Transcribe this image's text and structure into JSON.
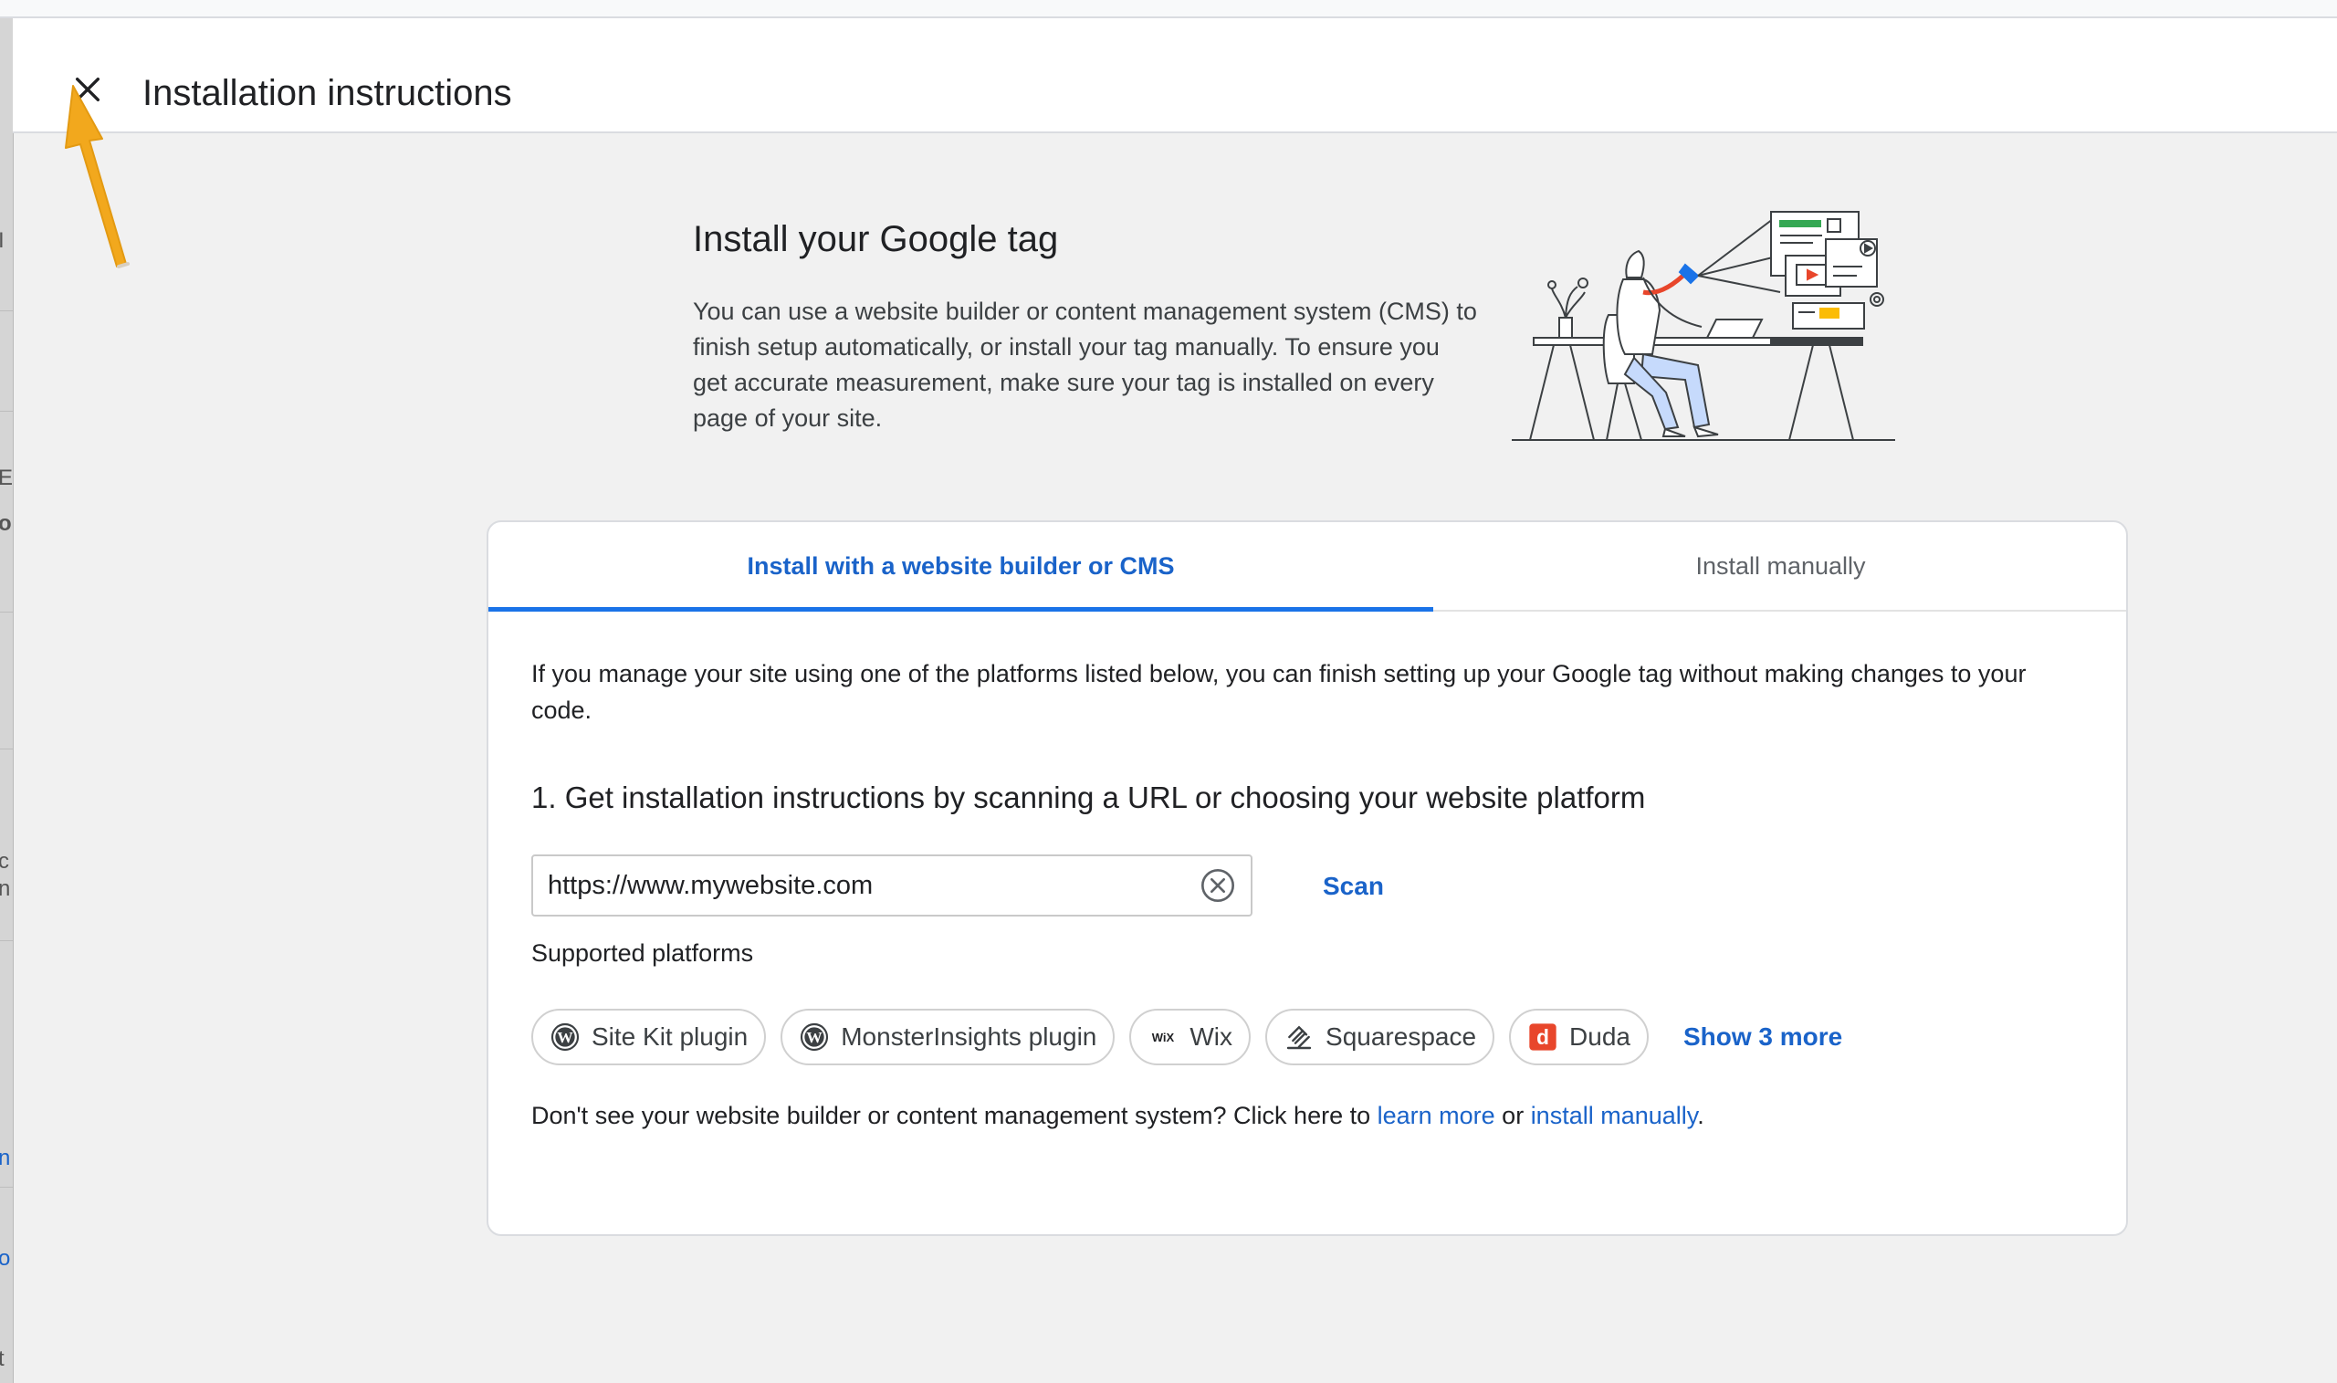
{
  "header": {
    "title": "Installation instructions"
  },
  "hero": {
    "title": "Install your Google tag",
    "description": "You can use a website builder or content management system (CMS) to finish setup automatically, or install your tag manually. To ensure you get accurate measurement, make sure your tag is installed on every page of your site."
  },
  "tabs": [
    {
      "label": "Install with a website builder or CMS",
      "selected": true
    },
    {
      "label": "Install manually",
      "selected": false
    }
  ],
  "main": {
    "intro": "If you manage your site using one of the platforms listed below, you can finish setting up your Google tag without making changes to your code.",
    "step_title": "1. Get installation instructions by scanning a URL or choosing your website platform",
    "url_value": "https://www.mywebsite.com",
    "scan_label": "Scan",
    "supported_label": "Supported platforms",
    "platforms": [
      {
        "label": "Site Kit plugin",
        "icon": "wordpress-icon"
      },
      {
        "label": "MonsterInsights plugin",
        "icon": "wordpress-icon"
      },
      {
        "label": "Wix",
        "icon": "wix-icon"
      },
      {
        "label": "Squarespace",
        "icon": "squarespace-icon"
      },
      {
        "label": "Duda",
        "icon": "duda-icon"
      }
    ],
    "show_more_label": "Show 3 more",
    "footer_prefix": "Don't see your website builder or content management system? Click here to ",
    "learn_more_label": "learn more",
    "footer_or": " or ",
    "install_manually_link": "install manually",
    "footer_suffix": "."
  },
  "colors": {
    "accent": "#1a73e8",
    "link": "#1a63c9",
    "background": "#f1f1f1",
    "annotation_arrow": "#f2a81d",
    "duda_brand": "#e8462b"
  }
}
